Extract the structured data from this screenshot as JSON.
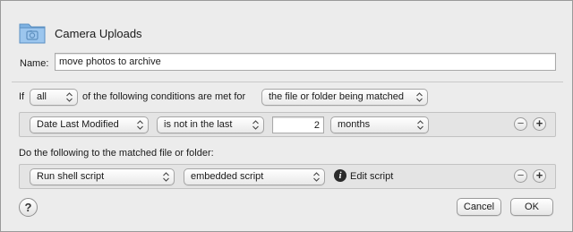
{
  "header": {
    "title": "Camera Uploads",
    "icon": "folder-camera-icon"
  },
  "name_field": {
    "label": "Name:",
    "value": "move photos to archive"
  },
  "conditions": {
    "if_label": "If",
    "match_value": "all",
    "middle_text": "of the following conditions are met for",
    "scope_value": "the file or folder being matched",
    "rule": {
      "attribute": "Date Last Modified",
      "operator": "is not in the last",
      "amount": "2",
      "unit": "months"
    }
  },
  "actions": {
    "heading": "Do the following to the matched file or folder:",
    "action": {
      "type": "Run shell script",
      "script_source": "embedded script",
      "edit_label": "Edit script"
    }
  },
  "buttons": {
    "help": "?",
    "cancel": "Cancel",
    "ok": "OK",
    "remove": "−",
    "add": "+"
  }
}
